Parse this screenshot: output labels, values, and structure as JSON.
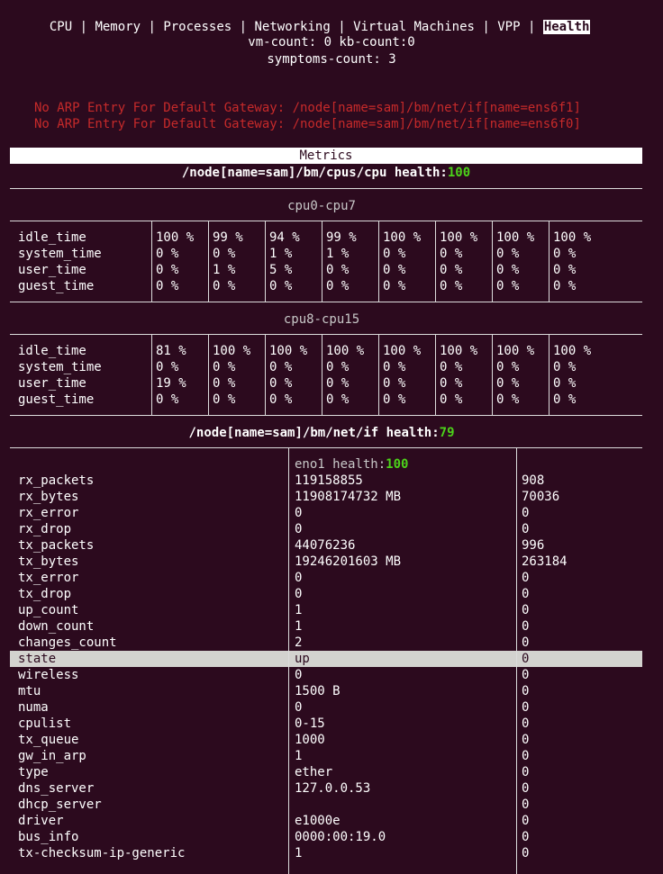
{
  "tabs": [
    {
      "label": "CPU"
    },
    {
      "label": "Memory"
    },
    {
      "label": "Processes"
    },
    {
      "label": "Networking"
    },
    {
      "label": "Virtual Machines"
    },
    {
      "label": "VPP"
    },
    {
      "label": "Health",
      "active": true
    }
  ],
  "summary": {
    "line1": "vm-count: 0 kb-count:0",
    "line2": "symptoms-count: 3"
  },
  "symptoms": [
    "No ARP Entry For Default Gateway: /node[name=sam]/bm/net/if[name=ens6f1]",
    "No ARP Entry For Default Gateway: /node[name=sam]/bm/net/if[name=ens6f0]"
  ],
  "metrics_title": "Metrics",
  "cpu_section": {
    "path": "/node[name=sam]/bm/cpus/cpu health:",
    "health": "100",
    "row_labels": [
      "idle_time",
      "system_time",
      "user_time",
      "guest_time"
    ],
    "groups": [
      {
        "title": "cpu0-cpu7",
        "cols": [
          [
            "100 %",
            "0 %",
            "0 %",
            "0 %"
          ],
          [
            "99 %",
            "0 %",
            "1 %",
            "0 %"
          ],
          [
            "94 %",
            "1 %",
            "5 %",
            "0 %"
          ],
          [
            "99 %",
            "1 %",
            "0 %",
            "0 %"
          ],
          [
            "100 %",
            "0 %",
            "0 %",
            "0 %"
          ],
          [
            "100 %",
            "0 %",
            "0 %",
            "0 %"
          ],
          [
            "100 %",
            "0 %",
            "0 %",
            "0 %"
          ],
          [
            "100 %",
            "0 %",
            "0 %",
            "0 %"
          ]
        ]
      },
      {
        "title": "cpu8-cpu15",
        "cols": [
          [
            "81 %",
            "0 %",
            "19 %",
            "0 %"
          ],
          [
            "100 %",
            "0 %",
            "0 %",
            "0 %"
          ],
          [
            "100 %",
            "0 %",
            "0 %",
            "0 %"
          ],
          [
            "100 %",
            "0 %",
            "0 %",
            "0 %"
          ],
          [
            "100 %",
            "0 %",
            "0 %",
            "0 %"
          ],
          [
            "100 %",
            "0 %",
            "0 %",
            "0 %"
          ],
          [
            "100 %",
            "0 %",
            "0 %",
            "0 %"
          ],
          [
            "100 %",
            "0 %",
            "0 %",
            "0 %"
          ]
        ]
      }
    ]
  },
  "net_section": {
    "path": "/node[name=sam]/bm/net/if health:",
    "health": "79",
    "iface_name": "eno1 health:",
    "iface_health": "100",
    "selected_row": "state",
    "rows": [
      [
        "rx_packets",
        "119158855",
        "908"
      ],
      [
        "rx_bytes",
        "11908174732 MB",
        "70036"
      ],
      [
        "rx_error",
        "0",
        "0"
      ],
      [
        "rx_drop",
        "0",
        "0"
      ],
      [
        "tx_packets",
        "44076236",
        "996"
      ],
      [
        "tx_bytes",
        "19246201603 MB",
        "263184"
      ],
      [
        "tx_error",
        "0",
        "0"
      ],
      [
        "tx_drop",
        "0",
        "0"
      ],
      [
        "up_count",
        "1",
        "0"
      ],
      [
        "down_count",
        "1",
        "0"
      ],
      [
        "changes_count",
        "2",
        "0"
      ],
      [
        "state",
        "up",
        "0"
      ],
      [
        "wireless",
        "0",
        "0"
      ],
      [
        "mtu",
        "1500 B",
        "0"
      ],
      [
        "numa",
        "0",
        "0"
      ],
      [
        "cpulist",
        "0-15",
        "0"
      ],
      [
        "tx_queue",
        "1000",
        "0"
      ],
      [
        "gw_in_arp",
        "1",
        "0"
      ],
      [
        "type",
        "ether",
        "0"
      ],
      [
        "dns_server",
        "127.0.0.53",
        "0"
      ],
      [
        "dhcp_server",
        "",
        "0"
      ],
      [
        "driver",
        "e1000e",
        "0"
      ],
      [
        "bus_info",
        "0000:00:19.0",
        "0"
      ],
      [
        "tx-checksum-ip-generic",
        "1",
        "0"
      ]
    ]
  }
}
